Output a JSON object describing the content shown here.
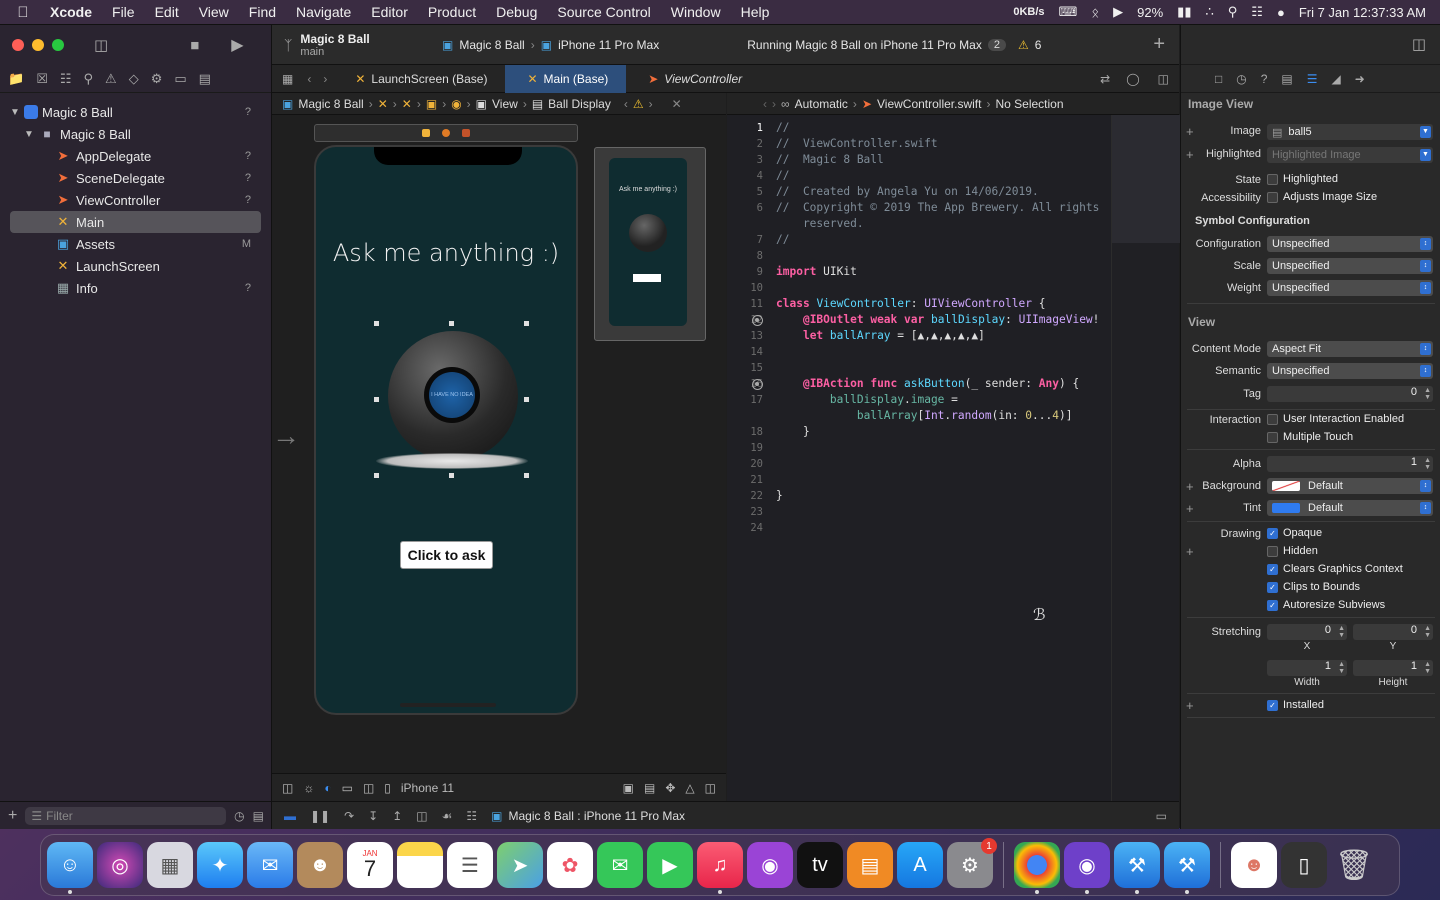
{
  "menubar": {
    "app": "Xcode",
    "items": [
      "File",
      "Edit",
      "View",
      "Find",
      "Navigate",
      "Editor",
      "Product",
      "Debug",
      "Source Control",
      "Window",
      "Help"
    ],
    "net": "0KB/s",
    "battery": "92%",
    "clock": "Fri 7 Jan  12:37:33 AM"
  },
  "toolbar": {
    "project": "Magic 8 Ball",
    "branch": "main",
    "scheme_target": "Magic 8 Ball",
    "device": "iPhone 11 Pro Max",
    "status": "Running Magic 8 Ball on iPhone 11 Pro Max",
    "status_count": "2",
    "warnings": "6"
  },
  "navigator": {
    "items": [
      {
        "label": "Magic 8 Ball",
        "badge": "?"
      },
      {
        "label": "Magic 8 Ball",
        "badge": ""
      },
      {
        "label": "AppDelegate",
        "badge": "?"
      },
      {
        "label": "SceneDelegate",
        "badge": "?"
      },
      {
        "label": "ViewController",
        "badge": "?"
      },
      {
        "label": "Main",
        "badge": ""
      },
      {
        "label": "Assets",
        "badge": "M"
      },
      {
        "label": "LaunchScreen",
        "badge": ""
      },
      {
        "label": "Info",
        "badge": "?"
      }
    ],
    "filter_placeholder": "Filter"
  },
  "tabs": [
    {
      "label": "LaunchScreen (Base)"
    },
    {
      "label": "Main (Base)"
    },
    {
      "label": "ViewController"
    }
  ],
  "jump_left": {
    "project": "Magic 8 Ball",
    "view": "View",
    "item": "Ball Display"
  },
  "jump_right": {
    "mode": "Automatic",
    "file": "ViewController.swift",
    "selection": "No Selection"
  },
  "canvas": {
    "ask_text": "Ask me anything :)",
    "ball_text": "I HAVE NO IDEA",
    "button_label": "Click to ask",
    "device_label": "iPhone 11"
  },
  "debug": {
    "target": "Magic 8 Ball : iPhone 11 Pro Max"
  },
  "inspector": {
    "section_image_view": "Image View",
    "image_label": "Image",
    "image_value": "ball5",
    "highlighted_label": "Highlighted",
    "highlighted_placeholder": "Highlighted Image",
    "state_label": "State",
    "state_check": "Highlighted",
    "accessibility_label": "Accessibility",
    "accessibility_check": "Adjusts Image Size",
    "symbol_title": "Symbol Configuration",
    "configuration_label": "Configuration",
    "configuration_value": "Unspecified",
    "scale_label": "Scale",
    "scale_value": "Unspecified",
    "weight_label": "Weight",
    "weight_value": "Unspecified",
    "section_view": "View",
    "content_mode_label": "Content Mode",
    "content_mode_value": "Aspect Fit",
    "semantic_label": "Semantic",
    "semantic_value": "Unspecified",
    "tag_label": "Tag",
    "tag_value": "0",
    "interaction_label": "Interaction",
    "interaction_1": "User Interaction Enabled",
    "interaction_2": "Multiple Touch",
    "alpha_label": "Alpha",
    "alpha_value": "1",
    "background_label": "Background",
    "background_value": "Default",
    "tint_label": "Tint",
    "tint_value": "Default",
    "drawing_label": "Drawing",
    "drawing": [
      "Opaque",
      "Hidden",
      "Clears Graphics Context",
      "Clips to Bounds",
      "Autoresize Subviews"
    ],
    "stretching_label": "Stretching",
    "stretch_x": "0",
    "stretch_y": "0",
    "stretch_w": "1",
    "stretch_h": "1",
    "x_label": "X",
    "y_label": "Y",
    "width_label": "Width",
    "height_label": "Height",
    "installed": "Installed"
  },
  "dock": {
    "calendar_month": "JAN",
    "calendar_day": "7",
    "settings_badge": "1"
  },
  "colors": {
    "accent": "#2f6fd1",
    "selection": "#2d4f7c",
    "canvas_bg": "#0f2c30"
  }
}
